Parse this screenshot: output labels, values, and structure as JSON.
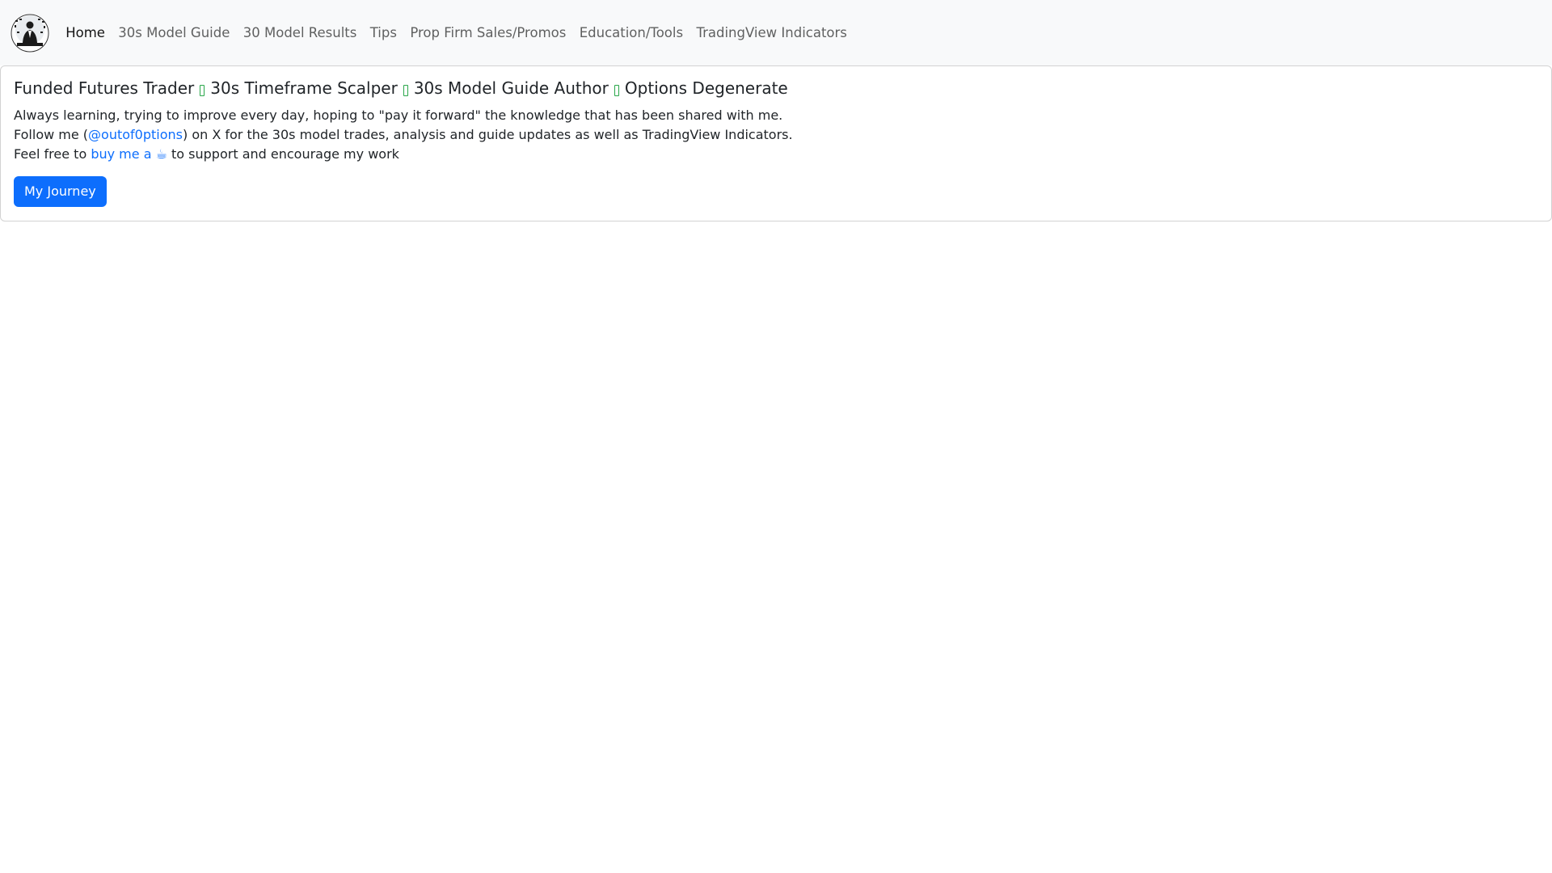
{
  "nav": {
    "logo_text": "OUT OF OPTIONS",
    "items": [
      {
        "label": "Home"
      },
      {
        "label": "30s Model Guide"
      },
      {
        "label": "30 Model Results"
      },
      {
        "label": "Tips"
      },
      {
        "label": "Prop Firm Sales/Promos"
      },
      {
        "label": "Education/Tools"
      },
      {
        "label": "TradingView Indicators"
      }
    ]
  },
  "hero": {
    "titles": [
      "Funded Futures Trader",
      "30s Timeframe Scalper",
      "30s Model Guide Author",
      "Options Degenerate"
    ],
    "line1": "Always learning, trying to improve every day, hoping to \"pay it forward\" the knowledge that has been shared with me.",
    "line2_prefix": "Follow me (",
    "line2_handle": "@outof0ptions",
    "line2_suffix": ") on X for the 30s model trades, analysis and guide updates as well as TradingView Indicators.",
    "line3_prefix": "Feel free to ",
    "line3_link": "buy me a ☕",
    "line3_suffix": " to support and encourage my work",
    "button_label": "My Journey"
  },
  "colors": {
    "accent": "#0d6efd",
    "separator": "#2aa74a",
    "navbar_bg": "#f8f9fa"
  }
}
